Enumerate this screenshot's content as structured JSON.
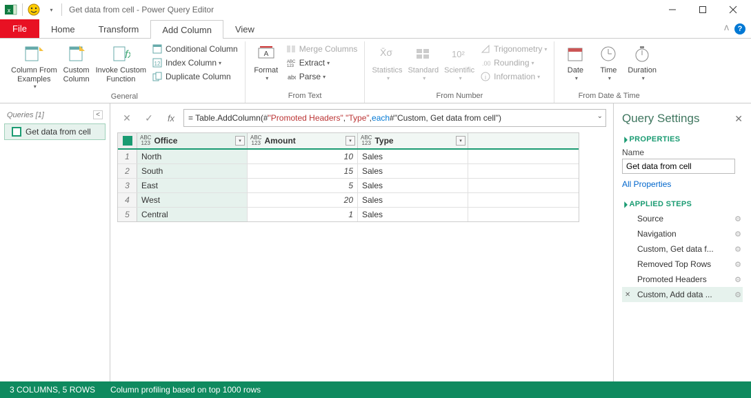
{
  "window": {
    "title": "Get data from cell - Power Query Editor"
  },
  "tabs": {
    "file": "File",
    "home": "Home",
    "transform": "Transform",
    "add_column": "Add Column",
    "view": "View"
  },
  "ribbon": {
    "general": {
      "label": "General",
      "col_from_examples": "Column From\nExamples",
      "custom_column": "Custom\nColumn",
      "invoke_custom_func": "Invoke Custom\nFunction",
      "conditional_column": "Conditional Column",
      "index_column": "Index Column",
      "duplicate_column": "Duplicate Column"
    },
    "from_text": {
      "label": "From Text",
      "format": "Format",
      "merge": "Merge Columns",
      "extract": "Extract",
      "parse": "Parse"
    },
    "from_number": {
      "label": "From Number",
      "statistics": "Statistics",
      "standard": "Standard",
      "scientific": "Scientific",
      "trig": "Trigonometry",
      "rounding": "Rounding",
      "information": "Information"
    },
    "from_datetime": {
      "label": "From Date & Time",
      "date": "Date",
      "time": "Time",
      "duration": "Duration"
    }
  },
  "queries": {
    "header": "Queries [1]",
    "items": [
      "Get data from cell"
    ]
  },
  "formula": {
    "prefix": "= Table.AddColumn(#",
    "arg1": "\"Promoted Headers\"",
    "sep1": ", ",
    "arg2": "\"Type\"",
    "sep2": ", ",
    "kw": "each",
    "rest": " #\"Custom, Get data from cell\")"
  },
  "table": {
    "col_office": "Office",
    "col_amount": "Amount",
    "col_type": "Type",
    "type_prefix": "ABC\n123",
    "rows": [
      {
        "n": 1,
        "office": "North",
        "amount": "10",
        "type": "Sales"
      },
      {
        "n": 2,
        "office": "South",
        "amount": "15",
        "type": "Sales"
      },
      {
        "n": 3,
        "office": "East",
        "amount": "5",
        "type": "Sales"
      },
      {
        "n": 4,
        "office": "West",
        "amount": "20",
        "type": "Sales"
      },
      {
        "n": 5,
        "office": "Central",
        "amount": "1",
        "type": "Sales"
      }
    ]
  },
  "settings": {
    "title": "Query Settings",
    "properties": "PROPERTIES",
    "name_label": "Name",
    "name_value": "Get data from cell",
    "all_props": "All Properties",
    "applied_steps": "APPLIED STEPS",
    "steps": [
      {
        "label": "Source",
        "gear": true
      },
      {
        "label": "Navigation",
        "gear": true
      },
      {
        "label": "Custom, Get data f...",
        "gear": true
      },
      {
        "label": "Removed Top Rows",
        "gear": true
      },
      {
        "label": "Promoted Headers",
        "gear": true
      },
      {
        "label": "Custom, Add data ...",
        "gear": true,
        "active": true
      }
    ]
  },
  "status": {
    "left": "3 COLUMNS, 5 ROWS",
    "right": "Column profiling based on top 1000 rows"
  }
}
